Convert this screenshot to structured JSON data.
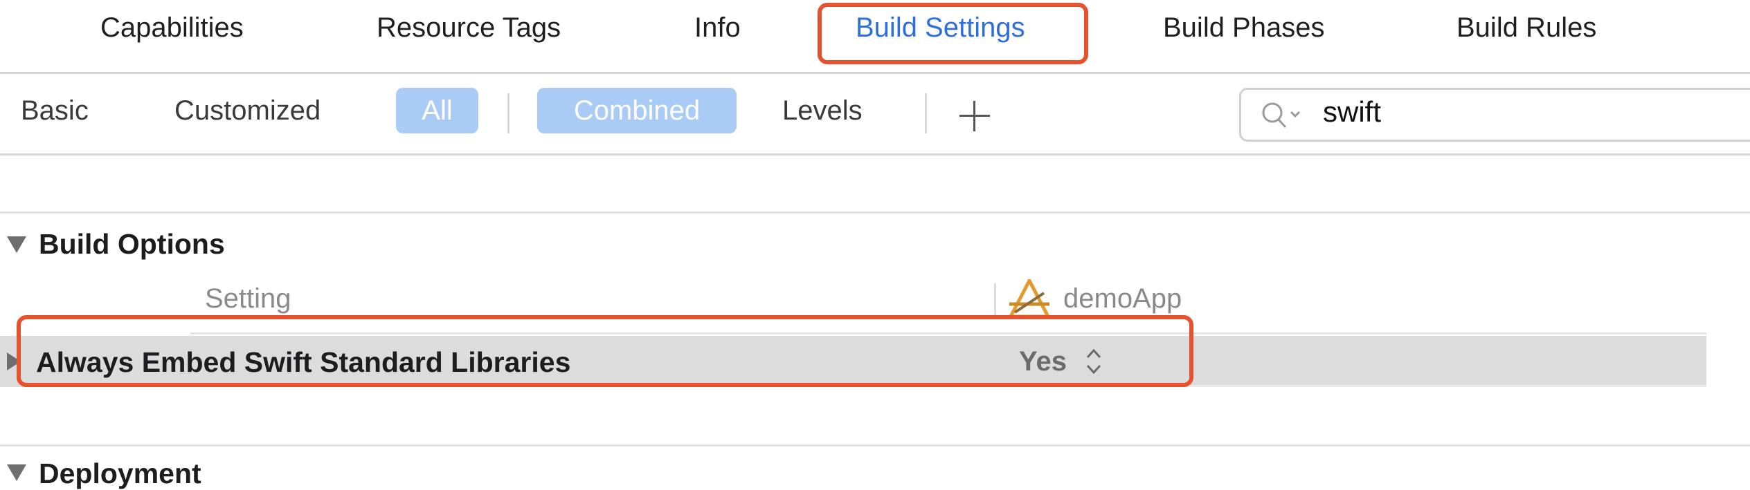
{
  "tabs": [
    {
      "label": "Capabilities"
    },
    {
      "label": "Resource Tags"
    },
    {
      "label": "Info"
    },
    {
      "label": "Build Settings",
      "active": true
    },
    {
      "label": "Build Phases"
    },
    {
      "label": "Build Rules"
    }
  ],
  "filters": {
    "basic": "Basic",
    "customized": "Customized",
    "all": "All",
    "combined": "Combined",
    "levels": "Levels"
  },
  "search": {
    "value": "swift"
  },
  "sections": [
    {
      "title": "Build Options",
      "column_setting": "Setting",
      "column_target": "demoApp",
      "rows": [
        {
          "name": "Always Embed Swift Standard Libraries",
          "value": "Yes"
        }
      ]
    },
    {
      "title": "Deployment"
    }
  ],
  "colors": {
    "accent": "#2f6fdc",
    "highlight": "#e5522d",
    "toggle_on": "#a9cbf5",
    "selected_row": "#dcdcdc"
  },
  "icons": {
    "search": "magnifier-icon",
    "add": "plus-icon",
    "app": "xcode-app-icon",
    "stepper": "updown-chevron-icon",
    "disclosure": "disclosure-triangle-icon"
  }
}
